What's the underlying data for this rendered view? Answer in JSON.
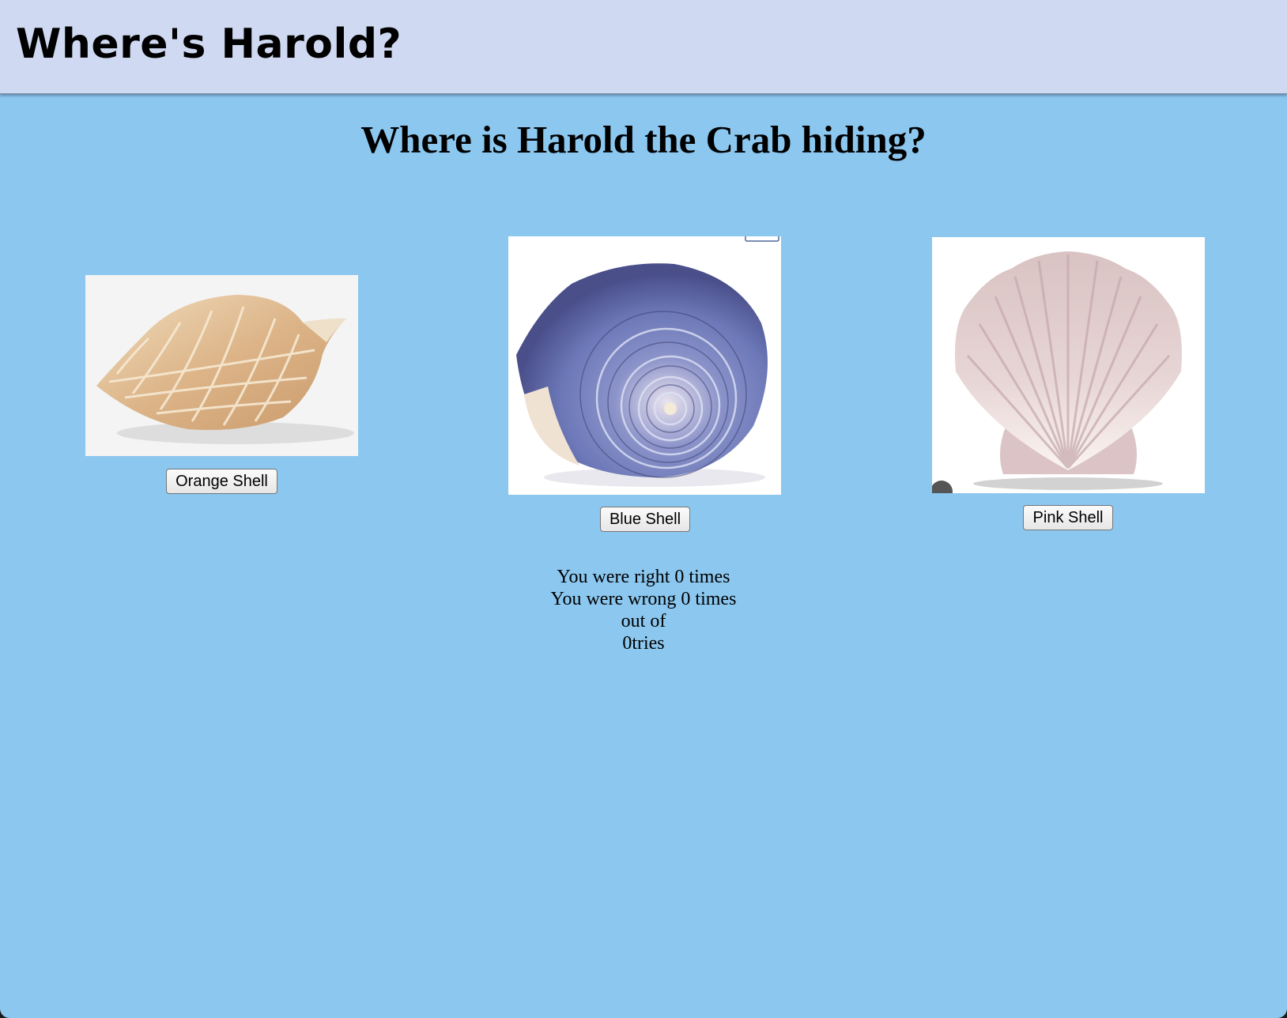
{
  "header": {
    "title": "Where's Harold?"
  },
  "main": {
    "question": "Where is Harold the Crab hiding?",
    "shells": [
      {
        "label": "Orange Shell",
        "image": "conch-shell-image"
      },
      {
        "label": "Blue Shell",
        "image": "spiral-shell-image"
      },
      {
        "label": "Pink Shell",
        "image": "scallop-shell-image"
      }
    ],
    "score": {
      "right_line": "You were right 0 times",
      "wrong_line": "You were wrong 0 times",
      "out_of": "out of",
      "tries_line": "0tries"
    }
  },
  "colors": {
    "page_background": "#8bc7ef",
    "header_background": "#cfd9f1"
  }
}
